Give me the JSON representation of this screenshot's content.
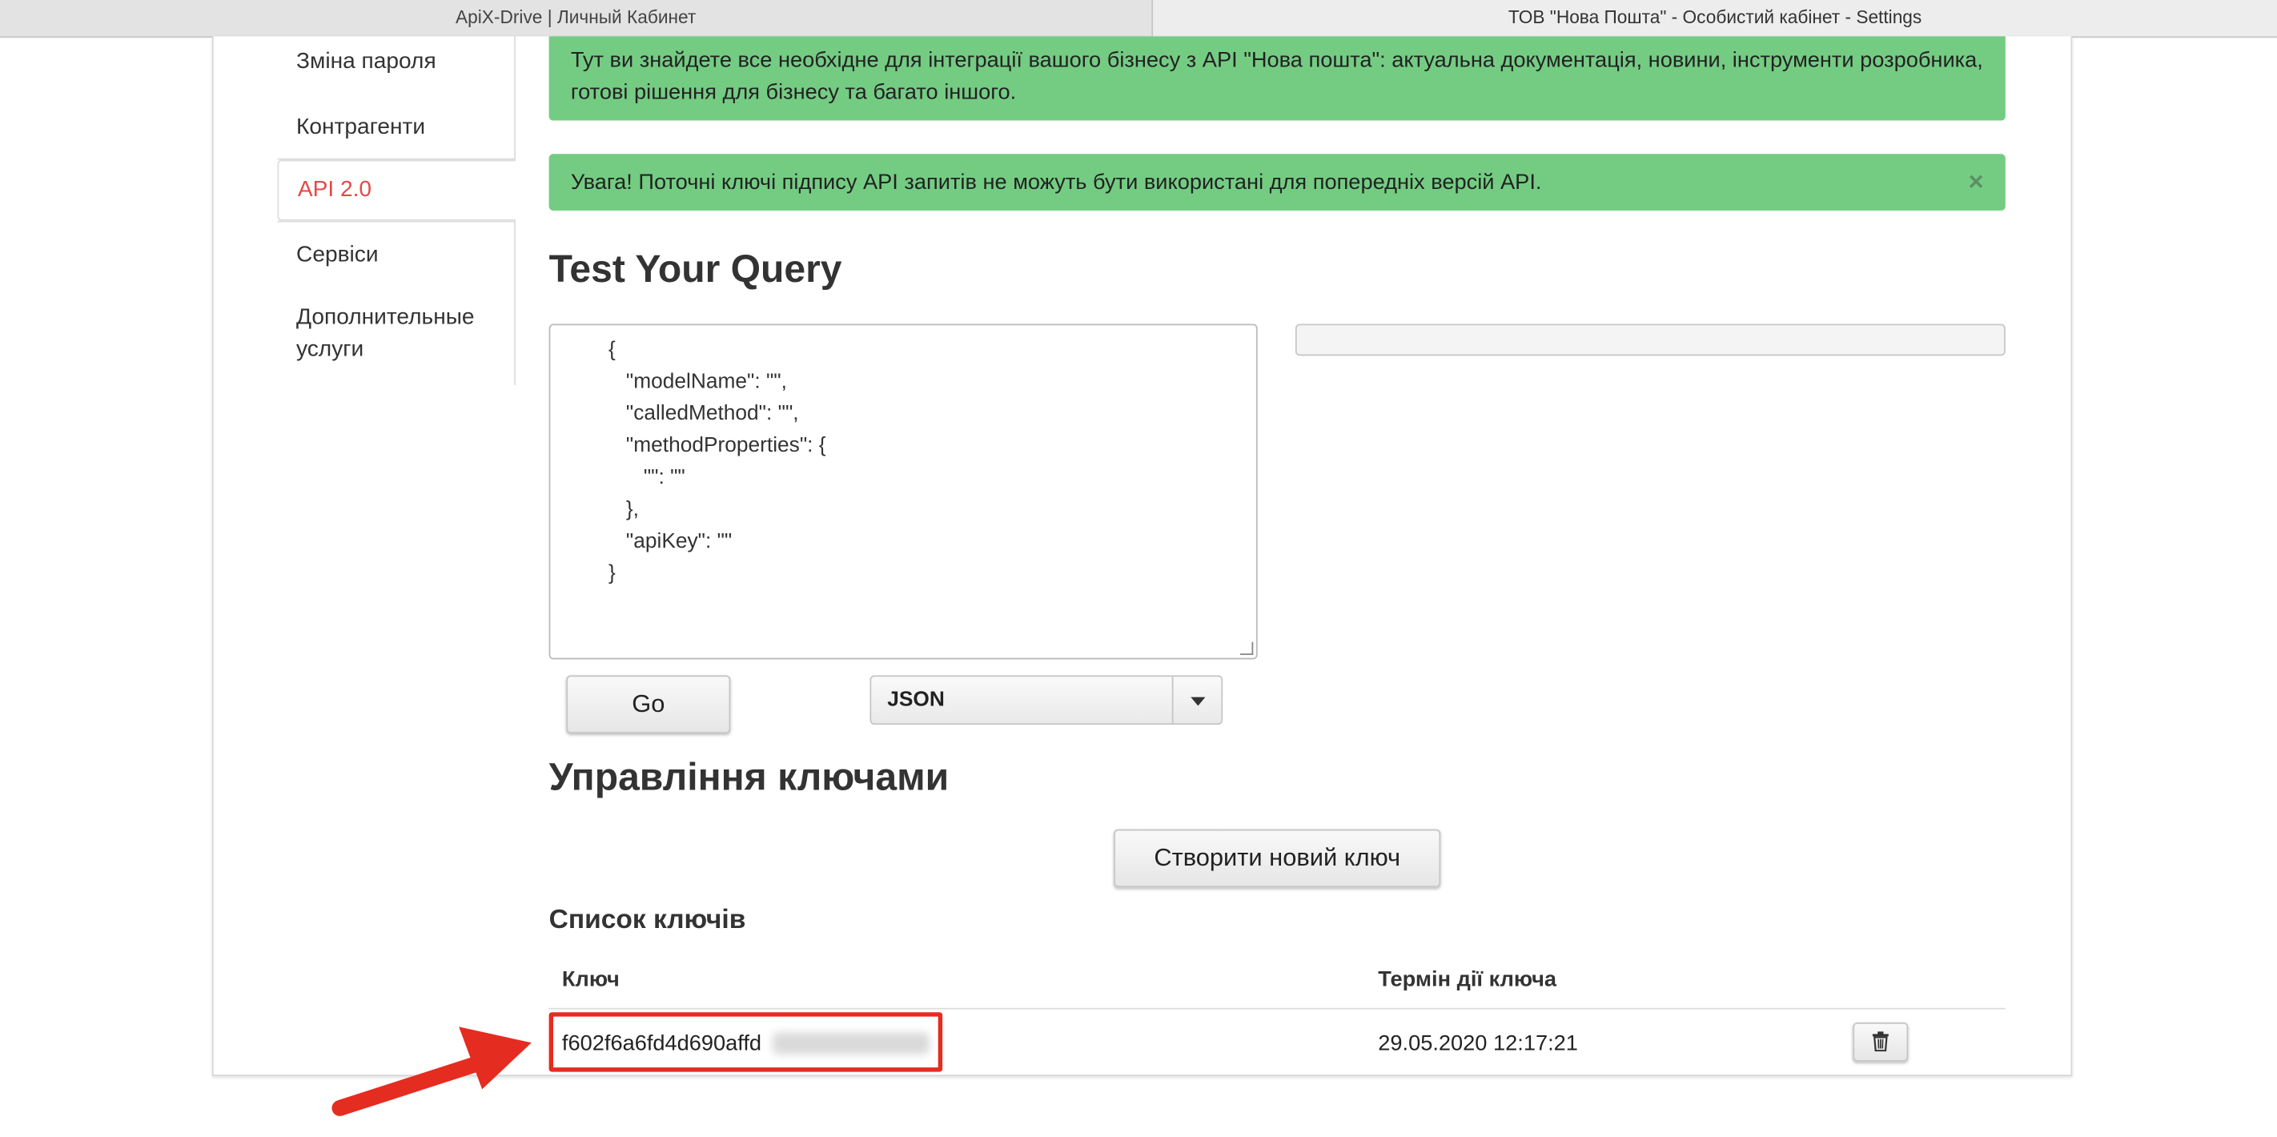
{
  "browser_tabs": [
    {
      "title": "ApiX-Drive | Личный Кабинет"
    },
    {
      "title": "ТОВ \"Нова Пошта\" - Особистий кабінет - Settings"
    }
  ],
  "sidebar": {
    "items": [
      {
        "label": "Зміна пароля",
        "active": false
      },
      {
        "label": "Контрагенти",
        "active": false
      },
      {
        "label": "API 2.0",
        "active": true
      },
      {
        "label": "Сервіси",
        "active": false
      },
      {
        "label": "Дополнительные услуги",
        "active": false
      }
    ]
  },
  "alerts": {
    "info": "Тут ви знайдете все необхідне для інтеграції вашого бізнесу з API \"Нова пошта\": актуальна документація, новини, інструменти розробника, готові рішення для бізнесу та багато іншого.",
    "warning": "Увага! Поточні ключі підпису API запитів не можуть бути використані для попередніх версій API.",
    "close_symbol": "×"
  },
  "test_query": {
    "title": "Test Your Query",
    "code": "{\n   \"modelName\": \"\",\n   \"calledMethod\": \"\",\n   \"methodProperties\": {\n      \"\": \"\"\n   },\n   \"apiKey\": \"\"\n}",
    "go_label": "Go",
    "format_selected": "JSON"
  },
  "key_management": {
    "title": "Управління ключами",
    "create_label": "Створити новий ключ",
    "list_title": "Список ключів",
    "columns": {
      "key": "Ключ",
      "expires": "Термін дії ключа"
    },
    "rows": [
      {
        "key": "f602f6a6fd4d690affd",
        "expires": "29.05.2020 12:17:21"
      }
    ]
  },
  "colors": {
    "alert_bg": "#74cc83",
    "active_nav": "#e64848",
    "highlight": "#e52c20"
  }
}
